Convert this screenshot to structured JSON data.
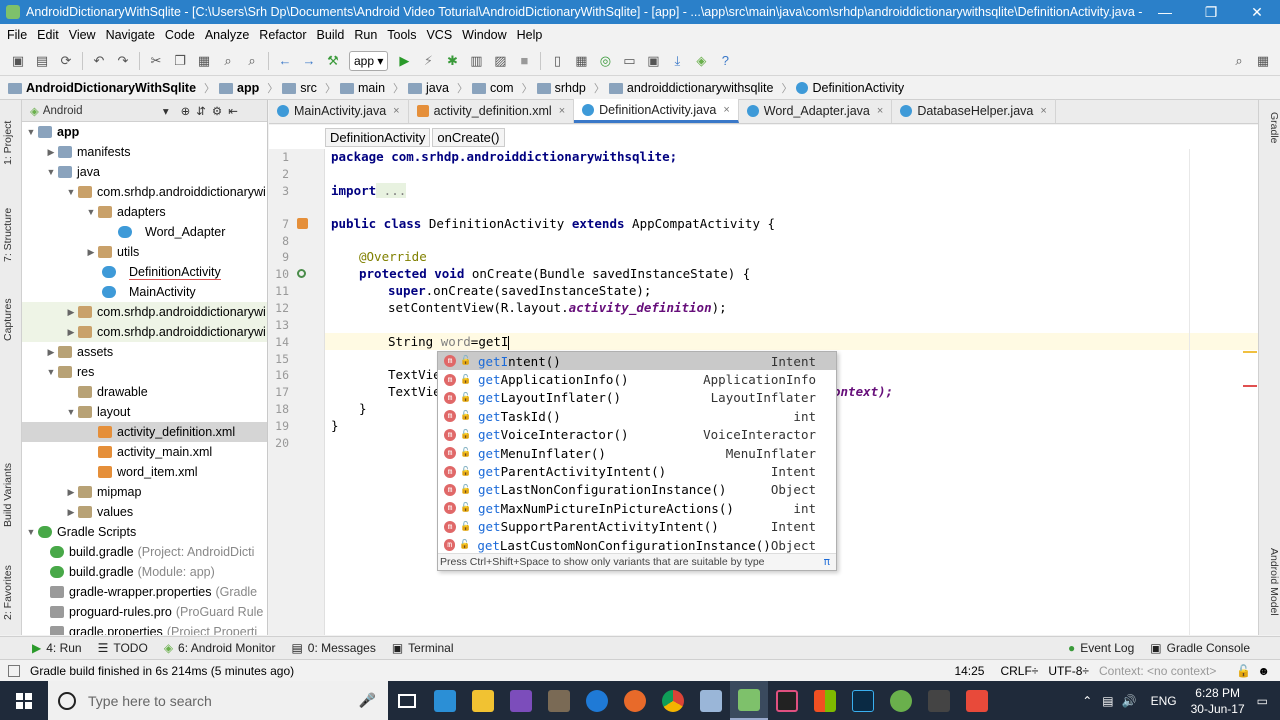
{
  "window": {
    "title": "AndroidDictionaryWithSqlite - [C:\\Users\\Srh Dp\\Documents\\Android Video Toturial\\AndroidDictionaryWithSqlite] - [app] - ...\\app\\src\\main\\java\\com\\srhdp\\androiddictionarywithsqlite\\DefinitionActivity.java - A...",
    "minimize": "—",
    "maximize": "❐",
    "close": "✕"
  },
  "menu": [
    "File",
    "Edit",
    "View",
    "Navigate",
    "Code",
    "Analyze",
    "Refactor",
    "Build",
    "Run",
    "Tools",
    "VCS",
    "Window",
    "Help"
  ],
  "toolbar": {
    "run_config": "app"
  },
  "breadcrumbs": [
    "AndroidDictionaryWithSqlite",
    "app",
    "src",
    "main",
    "java",
    "com",
    "srhdp",
    "androiddictionarywithsqlite",
    "DefinitionActivity"
  ],
  "left_tool_tabs": [
    "1: Project",
    "7: Structure",
    "Captures",
    "Build Variants",
    "2: Favorites"
  ],
  "right_tool_tabs": [
    "Gradle",
    "Android Model"
  ],
  "project": {
    "view_mode": "Android",
    "tree": [
      {
        "label": "app",
        "sub": ""
      },
      {
        "label": "manifests",
        "sub": ""
      },
      {
        "label": "java",
        "sub": ""
      },
      {
        "label": "com.srhdp.androiddictionarywi",
        "sub": ""
      },
      {
        "label": "adapters",
        "sub": ""
      },
      {
        "label": "Word_Adapter",
        "sub": ""
      },
      {
        "label": "utils",
        "sub": ""
      },
      {
        "label": "DefinitionActivity",
        "sub": ""
      },
      {
        "label": "MainActivity",
        "sub": ""
      },
      {
        "label": "com.srhdp.androiddictionarywi",
        "sub": ""
      },
      {
        "label": "com.srhdp.androiddictionarywi",
        "sub": ""
      },
      {
        "label": "assets",
        "sub": ""
      },
      {
        "label": "res",
        "sub": ""
      },
      {
        "label": "drawable",
        "sub": ""
      },
      {
        "label": "layout",
        "sub": ""
      },
      {
        "label": "activity_definition.xml",
        "sub": ""
      },
      {
        "label": "activity_main.xml",
        "sub": ""
      },
      {
        "label": "word_item.xml",
        "sub": ""
      },
      {
        "label": "mipmap",
        "sub": ""
      },
      {
        "label": "values",
        "sub": ""
      },
      {
        "label": "Gradle Scripts",
        "sub": ""
      },
      {
        "label": "build.gradle",
        "sub": "(Project: AndroidDicti"
      },
      {
        "label": "build.gradle",
        "sub": "(Module: app)"
      },
      {
        "label": "gradle-wrapper.properties",
        "sub": "(Gradle"
      },
      {
        "label": "proguard-rules.pro",
        "sub": "(ProGuard Rule"
      },
      {
        "label": "gradle.properties",
        "sub": "(Project Properti"
      }
    ]
  },
  "tabs": [
    "MainActivity.java",
    "activity_definition.xml",
    "DefinitionActivity.java",
    "Word_Adapter.java",
    "DatabaseHelper.java"
  ],
  "tab_close": "×",
  "code_crumbs": [
    "DefinitionActivity",
    "onCreate()"
  ],
  "code": {
    "line_numbers": [
      "1",
      "2",
      "3",
      "7",
      "8",
      "9",
      "10",
      "11",
      "12",
      "13",
      "14",
      "15",
      "16",
      "17",
      "18",
      "19",
      "20"
    ],
    "l1": "package com.srhdp.androiddictionarywithsqlite;",
    "l3_kw": "import",
    "l3_rest": " ...",
    "l7_kw1": "public class",
    "l7_mid": " DefinitionActivity ",
    "l7_kw2": "extends",
    "l7_end": " AppCompatActivity {",
    "l9": "@Override",
    "l10_kw": "protected void",
    "l10_rest": " onCreate(Bundle savedInstanceState) {",
    "l11_kw": "super",
    "l11_rest": ".onCreate(savedInstanceState);",
    "l12_a": "setContentView(R.layout.",
    "l12_b": "activity_definition",
    "l12_c": ");",
    "l14_a": "String ",
    "l14_b": "word",
    "l14_c": "=getI",
    "l16": "TextVie",
    "l17": "TextVie",
    "l17_tail": "ontext);",
    "l18": "}",
    "l19": "}"
  },
  "completion": {
    "items": [
      {
        "pre": "get",
        "hi": "I",
        "post": "ntent()",
        "type": "Intent"
      },
      {
        "pre": "get",
        "hi": "",
        "post": "ApplicationInfo()",
        "type": "ApplicationInfo"
      },
      {
        "pre": "get",
        "hi": "",
        "post": "LayoutInflater()",
        "type": "LayoutInflater"
      },
      {
        "pre": "get",
        "hi": "",
        "post": "TaskId()",
        "type": "int"
      },
      {
        "pre": "get",
        "hi": "",
        "post": "VoiceInteractor()",
        "type": "VoiceInteractor"
      },
      {
        "pre": "get",
        "hi": "",
        "post": "MenuInflater()",
        "type": "MenuInflater"
      },
      {
        "pre": "get",
        "hi": "",
        "post": "ParentActivityIntent()",
        "type": "Intent"
      },
      {
        "pre": "get",
        "hi": "",
        "post": "LastNonConfigurationInstance()",
        "type": "Object"
      },
      {
        "pre": "get",
        "hi": "",
        "post": "MaxNumPictureInPictureActions()",
        "type": "int"
      },
      {
        "pre": "get",
        "hi": "",
        "post": "SupportParentActivityIntent()",
        "type": "Intent"
      },
      {
        "pre": "get",
        "hi": "",
        "post": "LastCustomNonConfigurationInstance()",
        "type": "Object"
      }
    ],
    "footer": "Press Ctrl+Shift+Space to show only variants that are suitable by type",
    "pi": "π"
  },
  "bottom_tabs": [
    "4: Run",
    "TODO",
    "6: Android Monitor",
    "0: Messages",
    "Terminal"
  ],
  "bottom_right_tabs": [
    "Event Log",
    "Gradle Console"
  ],
  "status": {
    "message": "Gradle build finished in 6s 214ms (5 minutes ago)",
    "position": "14:25",
    "line_sep": "CRLF÷",
    "encoding": "UTF-8÷",
    "context": "Context: <no context>"
  },
  "taskbar": {
    "search_placeholder": "Type here to search",
    "lang": "ENG",
    "time": "6:28 PM",
    "date": "30-Jun-17"
  }
}
